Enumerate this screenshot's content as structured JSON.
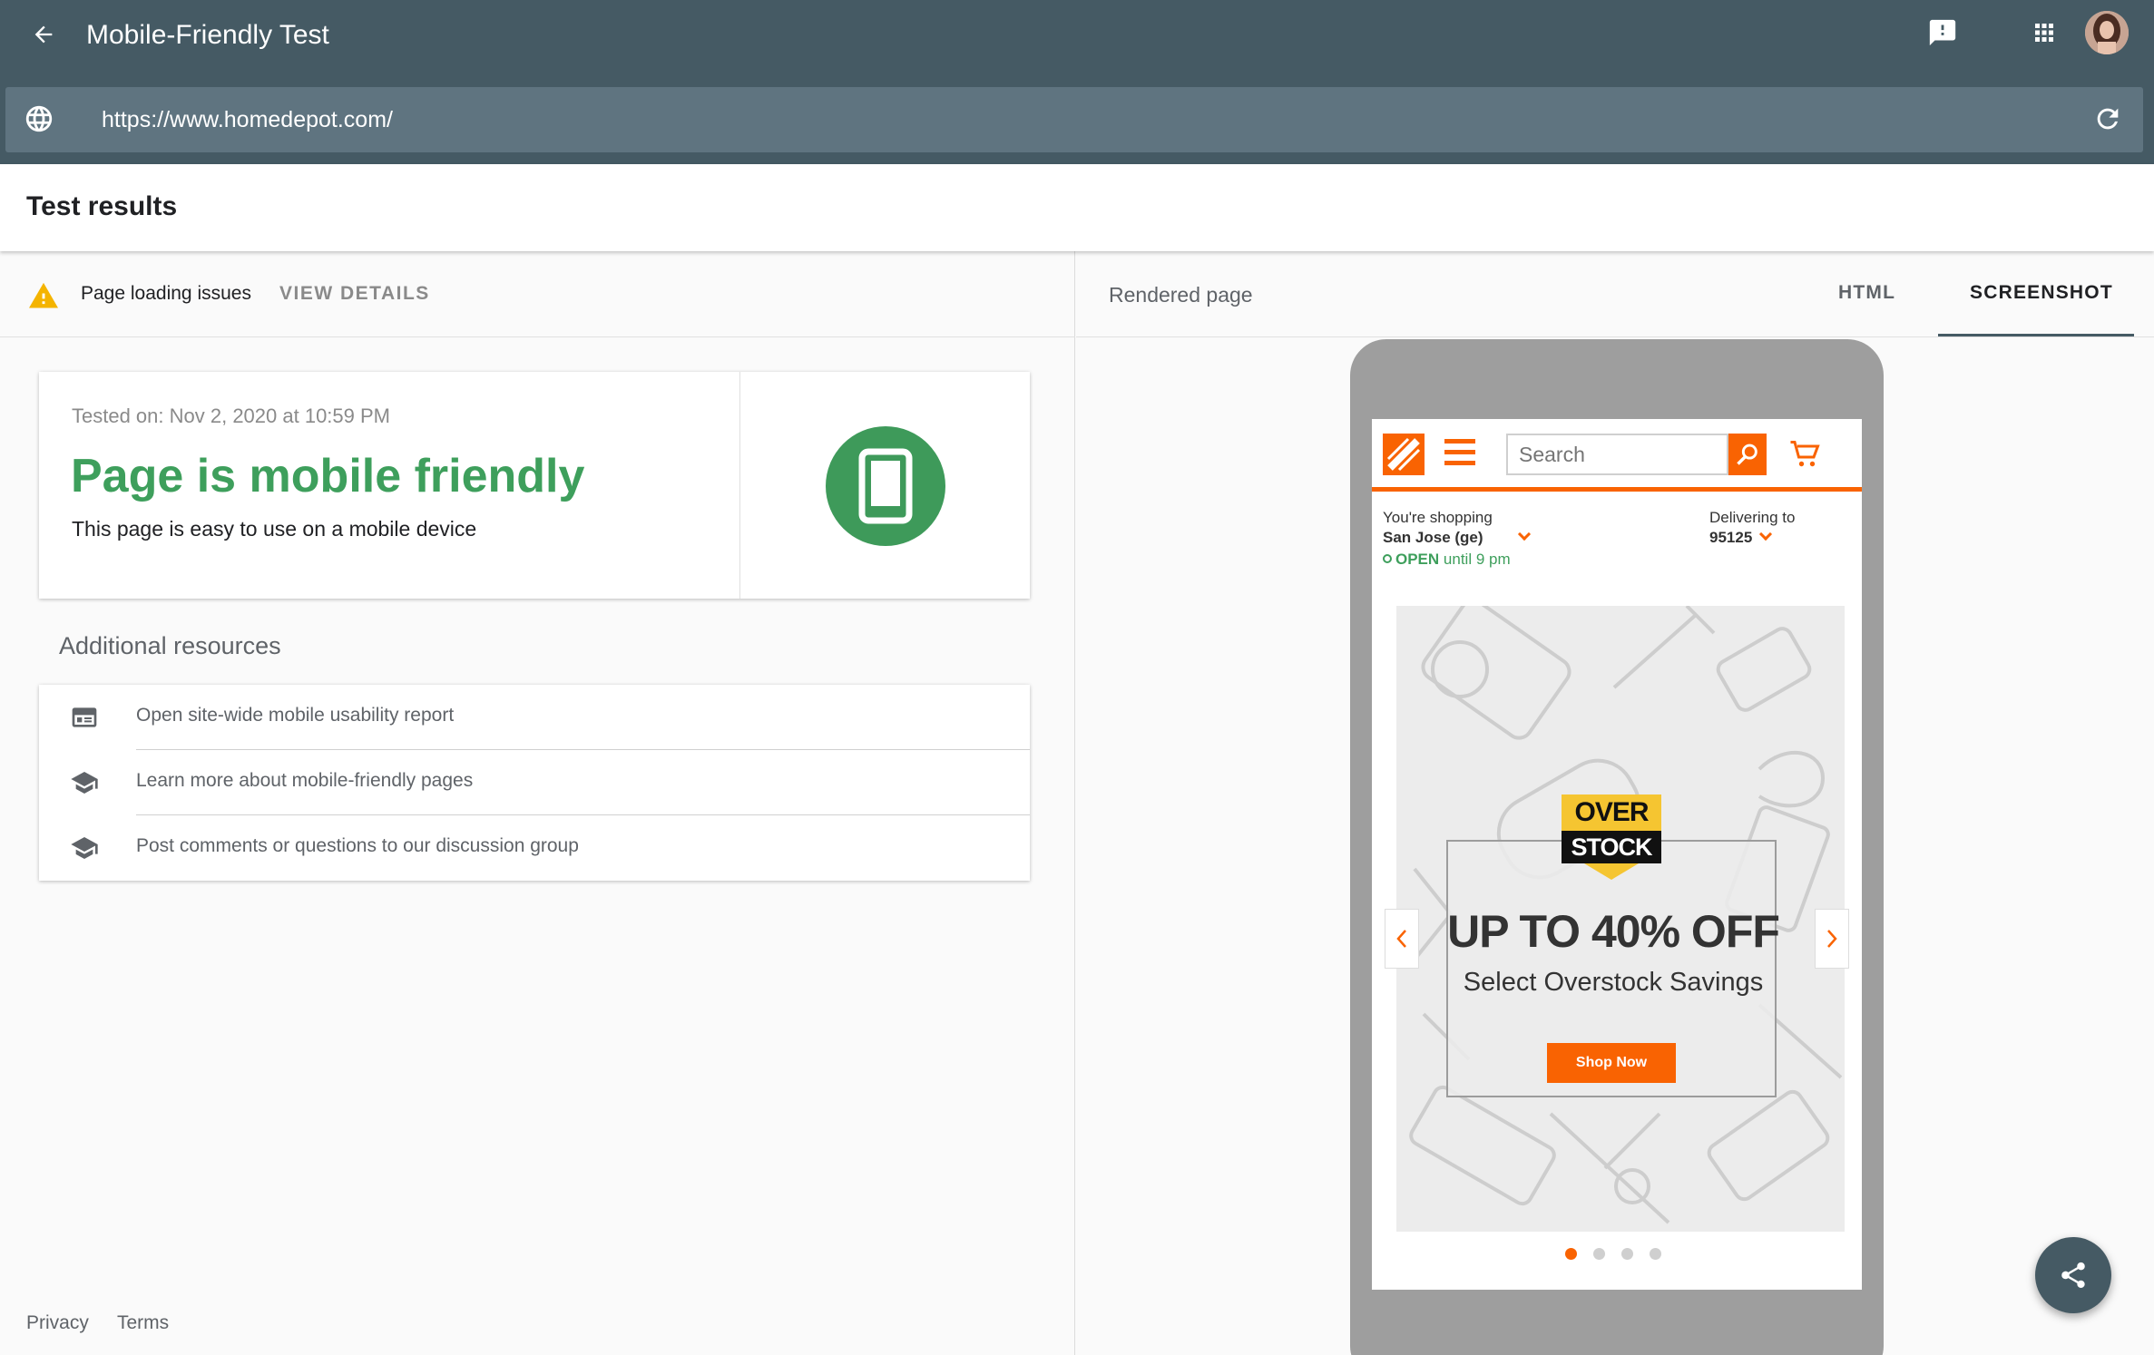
{
  "app": {
    "title": "Mobile-Friendly Test"
  },
  "url_bar": {
    "value": "https://www.homedepot.com/"
  },
  "results": {
    "title": "Test results",
    "issues_label": "Page loading issues",
    "view_details": "VIEW DETAILS",
    "tested_on": "Tested on: Nov 2, 2020 at 10:59 PM",
    "verdict": "Page is mobile friendly",
    "verdict_sub": "This page is easy to use on a mobile device"
  },
  "additional_resources": {
    "title": "Additional resources",
    "items": [
      {
        "label": "Open site-wide mobile usability report",
        "icon": "report-icon"
      },
      {
        "label": "Learn more about mobile-friendly pages",
        "icon": "school-icon"
      },
      {
        "label": "Post comments or questions to our discussion group",
        "icon": "school-icon"
      }
    ]
  },
  "footer": {
    "privacy": "Privacy",
    "terms": "Terms"
  },
  "right_pane": {
    "title": "Rendered page",
    "tabs": [
      "HTML",
      "SCREENSHOT"
    ],
    "active_tab": "SCREENSHOT"
  },
  "rendered_site": {
    "search_placeholder": "Search",
    "shopping_label": "You're shopping",
    "store_name": "San Jose (ge)",
    "open_status": "OPEN",
    "open_hours": "until 9 pm",
    "delivering_label": "Delivering to",
    "zip": "95125",
    "badge_top": "OVER",
    "badge_bottom": "STOCK",
    "headline": "UP TO 40% OFF",
    "subhead": "Select Overstock Savings",
    "cta": "Shop Now",
    "carousel_slides": 4,
    "carousel_active": 1
  },
  "colors": {
    "appbar": "#455a64",
    "success_green": "#3e9f5c",
    "warning_amber": "#f4b400",
    "homedepot_orange": "#f96302"
  }
}
